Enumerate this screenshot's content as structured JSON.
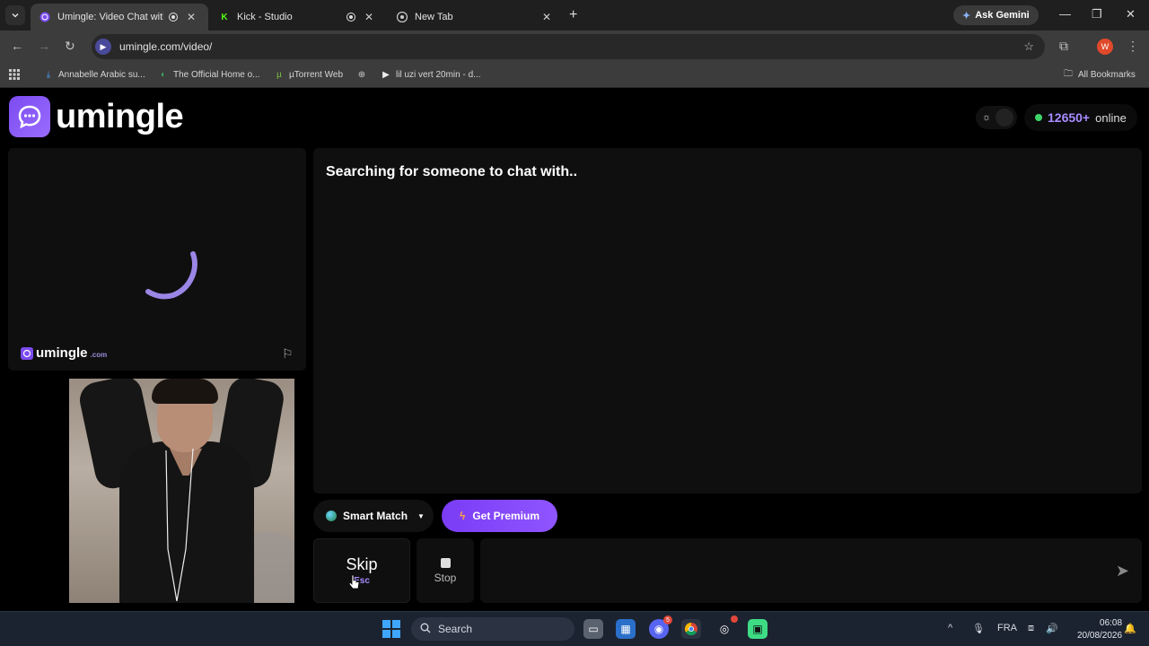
{
  "browser": {
    "tabs": [
      {
        "title": "Umingle: Video Chat with S",
        "active": true
      },
      {
        "title": "Kick - Studio",
        "active": false
      },
      {
        "title": "New Tab",
        "active": false
      }
    ],
    "ask_gemini": "Ask Gemini",
    "url": "umingle.com/video/",
    "profile_initial": "W",
    "bookmarks": [
      "Annabelle Arabic su...",
      "The Official Home o...",
      "µTorrent Web",
      "",
      "lil uzi vert 20min - d..."
    ],
    "all_bookmarks": "All Bookmarks"
  },
  "site": {
    "logo_text": "umingle",
    "online_count": "12650+",
    "online_label": "online",
    "watermark_name": "umingle",
    "watermark_domain": ".com"
  },
  "chat": {
    "status": "Searching for someone to chat with.."
  },
  "controls": {
    "smart_match": "Smart Match",
    "premium": "Get Premium",
    "skip": "Skip",
    "skip_hint": "Esc",
    "stop": "Stop",
    "message_placeholder": ""
  },
  "taskbar": {
    "search": "Search",
    "discord_badge": "5",
    "language": "FRA",
    "time": "06:08",
    "date": "20/08/2026"
  },
  "colors": {
    "accent": "#7b4bf0",
    "online_dot": "#3fd46a",
    "premium_bolt": "#ffa23a"
  }
}
